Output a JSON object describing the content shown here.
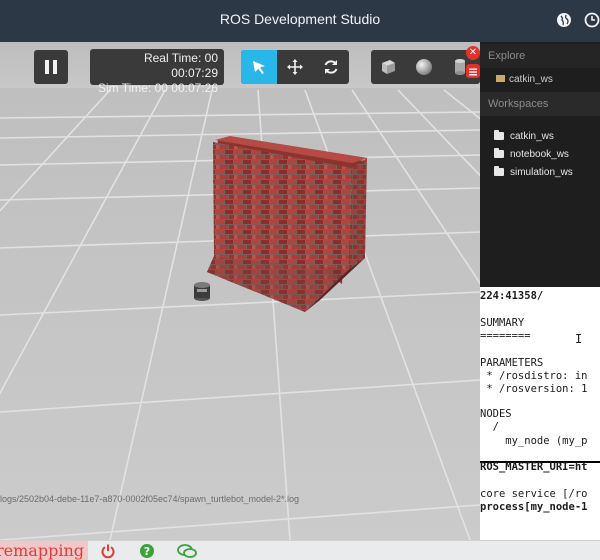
{
  "app": {
    "title": "ROS Development Studio"
  },
  "topbar": {
    "icons": [
      "globe-icon",
      "clock-icon"
    ]
  },
  "sim": {
    "real_time": "Real Time: 00 00:07:29",
    "sim_time": "Sim Time: 00 00:07:26",
    "pause_icon": "pause-icon",
    "modes": [
      "select-arrow-icon",
      "translate-icon",
      "rotate-icon"
    ],
    "active_mode": "select-arrow-icon",
    "shapes": [
      "box-icon",
      "sphere-icon",
      "cylinder-icon"
    ],
    "log": "logs/2502b04-debe-11e7-a870-0002f05ec74/spawn_turtlebot_model-2*.log"
  },
  "sidebar": {
    "explore_label": "Explore",
    "explore_item": "catkin_ws",
    "workspaces_label": "Workspaces",
    "workspaces": [
      "catkin_ws",
      "notebook_ws",
      "simulation_ws"
    ]
  },
  "terminal": {
    "lines": [
      "224:41358/",
      "",
      "SUMMARY",
      "========",
      "",
      "PARAMETERS",
      " * /rosdistro: in",
      " * /rosversion: 1",
      "",
      "NODES",
      "  /",
      "    my_node (my_p",
      "",
      "ROS_MASTER_URI=ht",
      "",
      "core service [/ro",
      "process[my_node-1"
    ]
  },
  "statusbar": {
    "text": "remapping",
    "icons": [
      "power-icon",
      "help-icon",
      "chat-icon"
    ],
    "accent": "#e13c37"
  },
  "colors": {
    "topbar": "#2d3846",
    "toolbar_active": "#29b6e8",
    "brick": "#a83b35",
    "sidebar_bg": "#1e1e1e"
  }
}
